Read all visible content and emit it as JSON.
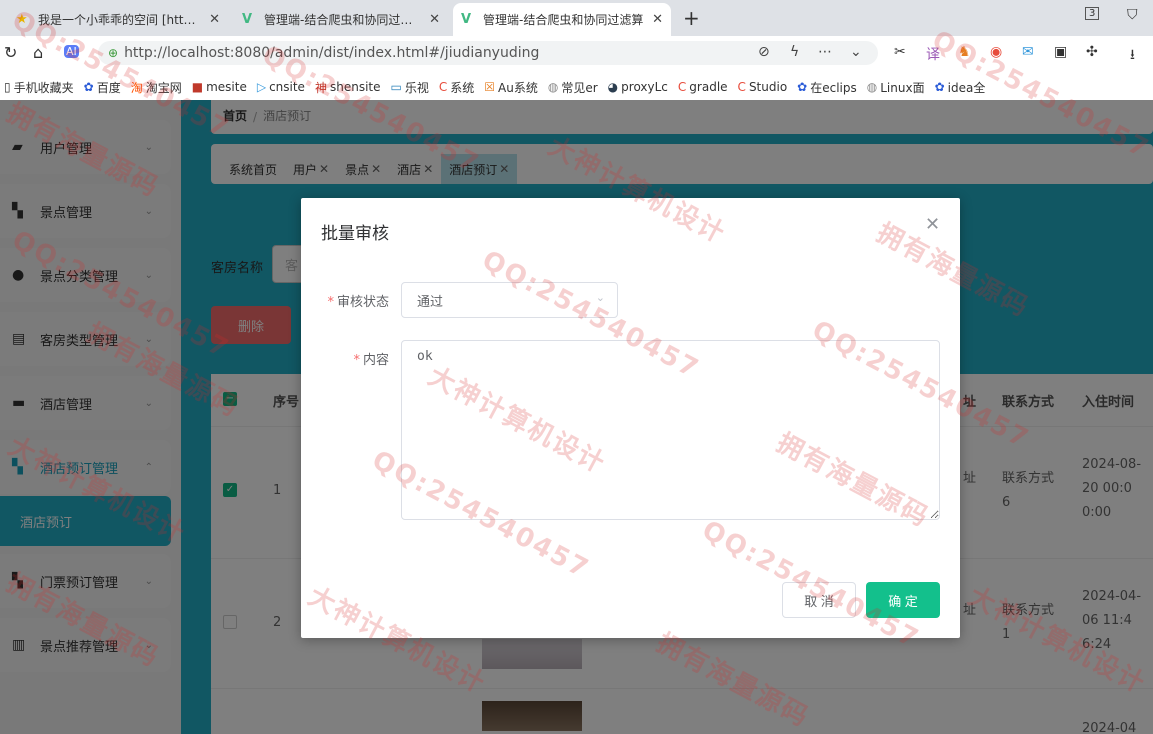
{
  "browser": {
    "tabs": [
      {
        "title": "我是一个小乖乖的空间 [http://"
      },
      {
        "title": "管理端-结合爬虫和协同过滤算"
      },
      {
        "title": "管理端-结合爬虫和协同过滤算"
      }
    ],
    "url": "http://localhost:8080/admin/dist/index.html#/jiudianyuding",
    "tab_count": "3",
    "bookmarks": [
      "手机收藏夹",
      "百度",
      "淘宝网",
      "mesite",
      "cnsite",
      "shensite",
      "乐视",
      "系统",
      "Au系统",
      "常见er",
      "proxyLc",
      "gradle",
      "Studio",
      "在eclips",
      "Linux面",
      "idea全"
    ]
  },
  "sidebar": {
    "items": [
      {
        "label": "用户管理"
      },
      {
        "label": "景点管理"
      },
      {
        "label": "景点分类管理"
      },
      {
        "label": "客房类型管理"
      },
      {
        "label": "酒店管理"
      },
      {
        "label": "酒店预订管理"
      },
      {
        "label": "门票预订管理"
      },
      {
        "label": "景点推荐管理"
      }
    ],
    "submenu_label": "酒店预订"
  },
  "breadcrumb": {
    "home": "首页",
    "separator": "/",
    "current": "酒店预订"
  },
  "tags": [
    "系统首页",
    "用户",
    "景点",
    "酒店",
    "酒店预订"
  ],
  "search": {
    "label": "客房名称",
    "placeholder": "客"
  },
  "toolbar": {
    "delete_label": "删除"
  },
  "table": {
    "headers": {
      "index": "序号",
      "address": "址",
      "contact": "联系方式",
      "checkin": "入住时间"
    },
    "rows": [
      {
        "index": "1",
        "address": "址",
        "contact": "联系方式6",
        "checkin": "2024-08-20 00:00:00",
        "checked": true
      },
      {
        "index": "2",
        "address": "址",
        "contact": "联系方式1",
        "checkin": "2024-04-06 11:46:24",
        "checked": false
      }
    ],
    "partial_row_text": "2024-04"
  },
  "dialog": {
    "title": "批量审核",
    "status_label": "审核状态",
    "status_value": "通过",
    "content_label": "内容",
    "content_value": "ok",
    "cancel_label": "取 消",
    "confirm_label": "确 定"
  },
  "watermarks": [
    "QQ:254540457",
    "大神计算机设计",
    "拥有海量源码"
  ],
  "colors": {
    "accent": "#22aec7",
    "confirm": "#13c08c",
    "danger": "#f56c6c",
    "checkbox": "#12b886"
  }
}
